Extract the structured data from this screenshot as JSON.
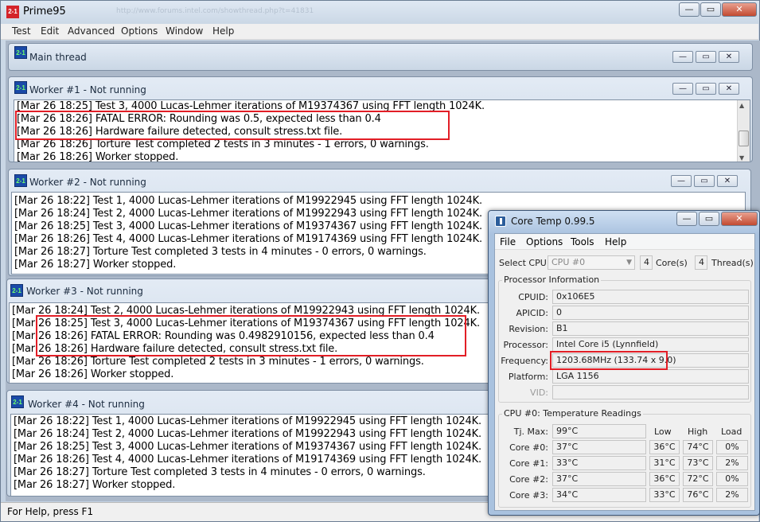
{
  "app": {
    "title": "Prime95",
    "url_text": "http://www.forums.intel.com/showthread.php?t=41831",
    "status": "For Help, press F1"
  },
  "menu": [
    "Test",
    "Edit",
    "Advanced",
    "Options",
    "Window",
    "Help"
  ],
  "caption_buttons": {
    "minimize": "—",
    "restore": "▭",
    "close": "✕"
  },
  "main_thread": {
    "title": "Main thread"
  },
  "workers": [
    {
      "title": "Worker #1 - Not running",
      "lines": [
        "[Mar 26 18:25] Test 3, 4000 Lucas-Lehmer iterations of M19374367 using FFT length 1024K.",
        "[Mar 26 18:26] FATAL ERROR: Rounding was 0.5, expected less than 0.4",
        "[Mar 26 18:26] Hardware failure detected, consult stress.txt file.",
        "[Mar 26 18:26] Torture Test completed 2 tests in 3 minutes - 1 errors, 0 warnings.",
        "[Mar 26 18:26] Worker stopped."
      ]
    },
    {
      "title": "Worker #2 - Not running",
      "lines": [
        "[Mar 26 18:22] Test 1, 4000 Lucas-Lehmer iterations of M19922945 using FFT length 1024K.",
        "[Mar 26 18:24] Test 2, 4000 Lucas-Lehmer iterations of M19922943 using FFT length 1024K.",
        "[Mar 26 18:25] Test 3, 4000 Lucas-Lehmer iterations of M19374367 using FFT length 1024K.",
        "[Mar 26 18:26] Test 4, 4000 Lucas-Lehmer iterations of M19174369 using FFT length 1024K.",
        "[Mar 26 18:27] Torture Test completed 3 tests in 4 minutes - 0 errors, 0 warnings.",
        "[Mar 26 18:27] Worker stopped."
      ]
    },
    {
      "title": "Worker #3 - Not running",
      "lines": [
        "[Mar 26 18:24] Test 2, 4000 Lucas-Lehmer iterations of M19922943 using FFT length 1024K.",
        "[Mar 26 18:25] Test 3, 4000 Lucas-Lehmer iterations of M19374367 using FFT length 1024K.",
        "[Mar 26 18:26] FATAL ERROR: Rounding was 0.4982910156, expected less than 0.4",
        "[Mar 26 18:26] Hardware failure detected, consult stress.txt file.",
        "[Mar 26 18:26] Torture Test completed 2 tests in 3 minutes - 1 errors, 0 warnings.",
        "[Mar 26 18:26] Worker stopped."
      ]
    },
    {
      "title": "Worker #4 - Not running",
      "lines": [
        "[Mar 26 18:22] Test 1, 4000 Lucas-Lehmer iterations of M19922945 using FFT length 1024K.",
        "[Mar 26 18:24] Test 2, 4000 Lucas-Lehmer iterations of M19922943 using FFT length 1024K.",
        "[Mar 26 18:25] Test 3, 4000 Lucas-Lehmer iterations of M19374367 using FFT length 1024K.",
        "[Mar 26 18:26] Test 4, 4000 Lucas-Lehmer iterations of M19174369 using FFT length 1024K.",
        "[Mar 26 18:27] Torture Test completed 3 tests in 4 minutes - 0 errors, 0 warnings.",
        "[Mar 26 18:27] Worker stopped."
      ]
    }
  ],
  "coretemp": {
    "title": "Core Temp 0.99.5",
    "menu": [
      "File",
      "Options",
      "Tools",
      "Help"
    ],
    "select_cpu_label": "Select CPU:",
    "select_cpu_value": "CPU #0",
    "cores_count": "4",
    "cores_label": "Core(s)",
    "threads_count": "4",
    "threads_label": "Thread(s)",
    "processor_info_title": "Processor Information",
    "info": [
      {
        "label": "CPUID:",
        "value": "0x106E5"
      },
      {
        "label": "APICID:",
        "value": "0"
      },
      {
        "label": "Revision:",
        "value": "B1"
      },
      {
        "label": "Processor:",
        "value": "Intel Core i5 (Lynnfield)"
      },
      {
        "label": "Frequency:",
        "value": "1203.68MHz (133.74 x 9.0)"
      },
      {
        "label": "Platform:",
        "value": "LGA 1156"
      },
      {
        "label": "VID:",
        "value": ""
      }
    ],
    "temps_title": "CPU #0: Temperature Readings",
    "temp_headers": {
      "low": "Low",
      "high": "High",
      "load": "Load"
    },
    "tjmax_label": "Tj. Max:",
    "tjmax_value": "99°C",
    "cores": [
      {
        "label": "Core #0:",
        "temp": "37°C",
        "low": "36°C",
        "high": "74°C",
        "load": "0%"
      },
      {
        "label": "Core #1:",
        "temp": "33°C",
        "low": "31°C",
        "high": "73°C",
        "load": "2%"
      },
      {
        "label": "Core #2:",
        "temp": "37°C",
        "low": "36°C",
        "high": "72°C",
        "load": "0%"
      },
      {
        "label": "Core #3:",
        "temp": "34°C",
        "low": "33°C",
        "high": "76°C",
        "load": "2%"
      }
    ]
  }
}
